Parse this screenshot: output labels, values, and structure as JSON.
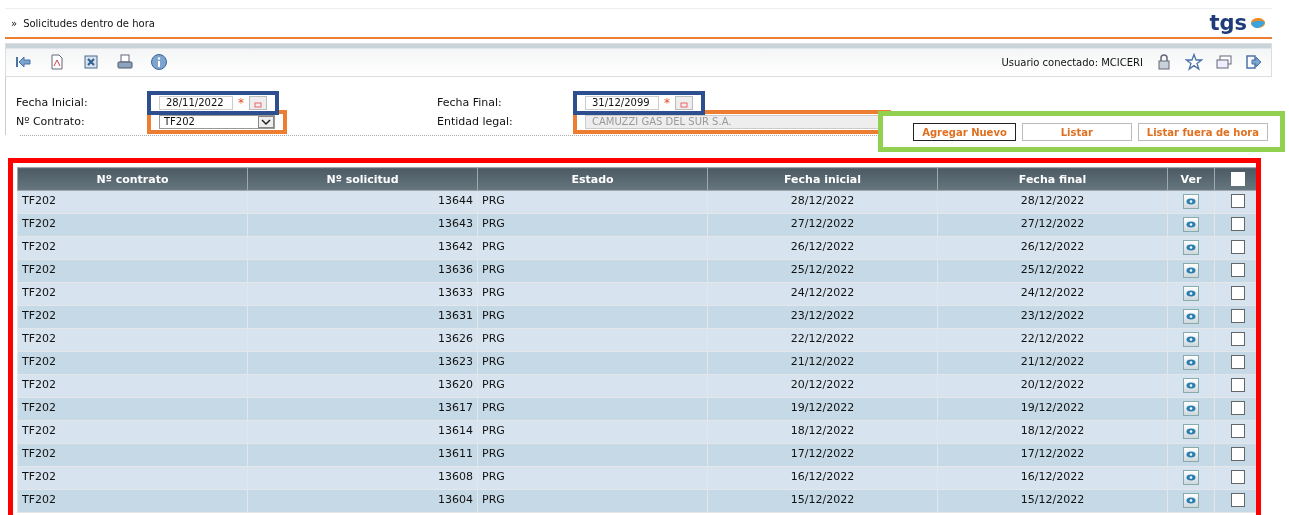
{
  "header": {
    "breadcrumb_mark": "»",
    "title": "Solicitudes dentro de hora",
    "logo": "tgs"
  },
  "toolbar": {
    "user_label": "Usuario conectado: MCICERI"
  },
  "form": {
    "fecha_inicial": {
      "label": "Fecha Inicial:",
      "value": "28/11/2022",
      "required": "*",
      "color": "#2e4f8f"
    },
    "contrato": {
      "label": "Nº Contrato:",
      "value": "TF202",
      "color": "#ed7d31"
    },
    "fecha_final": {
      "label": "Fecha Final:",
      "value": "31/12/2099",
      "required": "*",
      "color": "#2e4f8f"
    },
    "entidad": {
      "label": "Entidad legal:",
      "value": "CAMUZZI GAS DEL SUR S.A.",
      "disabled": true,
      "color": "#ed7d31"
    }
  },
  "buttons": {
    "color": "#92d050",
    "items": [
      {
        "label": "Agregar Nuevo",
        "selected": true
      },
      {
        "label": "Listar",
        "selected": false
      },
      {
        "label": "Listar fuera de hora",
        "selected": false
      }
    ]
  },
  "table": {
    "color": "#ff0000",
    "all_checked": false,
    "columns": [
      "Nº contrato",
      "Nº solicitud",
      "Estado",
      "Fecha inicial",
      "Fecha final",
      "Ver"
    ],
    "rows": [
      {
        "contrato": "TF202",
        "solicitud": "13644",
        "estado": "PRG",
        "inicial": "28/12/2022",
        "final": "28/12/2022",
        "checked": false
      },
      {
        "contrato": "TF202",
        "solicitud": "13643",
        "estado": "PRG",
        "inicial": "27/12/2022",
        "final": "27/12/2022",
        "checked": false
      },
      {
        "contrato": "TF202",
        "solicitud": "13642",
        "estado": "PRG",
        "inicial": "26/12/2022",
        "final": "26/12/2022",
        "checked": false
      },
      {
        "contrato": "TF202",
        "solicitud": "13636",
        "estado": "PRG",
        "inicial": "25/12/2022",
        "final": "25/12/2022",
        "checked": false
      },
      {
        "contrato": "TF202",
        "solicitud": "13633",
        "estado": "PRG",
        "inicial": "24/12/2022",
        "final": "24/12/2022",
        "checked": false
      },
      {
        "contrato": "TF202",
        "solicitud": "13631",
        "estado": "PRG",
        "inicial": "23/12/2022",
        "final": "23/12/2022",
        "checked": false
      },
      {
        "contrato": "TF202",
        "solicitud": "13626",
        "estado": "PRG",
        "inicial": "22/12/2022",
        "final": "22/12/2022",
        "checked": false
      },
      {
        "contrato": "TF202",
        "solicitud": "13623",
        "estado": "PRG",
        "inicial": "21/12/2022",
        "final": "21/12/2022",
        "checked": false
      },
      {
        "contrato": "TF202",
        "solicitud": "13620",
        "estado": "PRG",
        "inicial": "20/12/2022",
        "final": "20/12/2022",
        "checked": false
      },
      {
        "contrato": "TF202",
        "solicitud": "13617",
        "estado": "PRG",
        "inicial": "19/12/2022",
        "final": "19/12/2022",
        "checked": false
      },
      {
        "contrato": "TF202",
        "solicitud": "13614",
        "estado": "PRG",
        "inicial": "18/12/2022",
        "final": "18/12/2022",
        "checked": false
      },
      {
        "contrato": "TF202",
        "solicitud": "13611",
        "estado": "PRG",
        "inicial": "17/12/2022",
        "final": "17/12/2022",
        "checked": false
      },
      {
        "contrato": "TF202",
        "solicitud": "13608",
        "estado": "PRG",
        "inicial": "16/12/2022",
        "final": "16/12/2022",
        "checked": false
      },
      {
        "contrato": "TF202",
        "solicitud": "13604",
        "estado": "PRG",
        "inicial": "15/12/2022",
        "final": "15/12/2022",
        "checked": false
      }
    ]
  }
}
